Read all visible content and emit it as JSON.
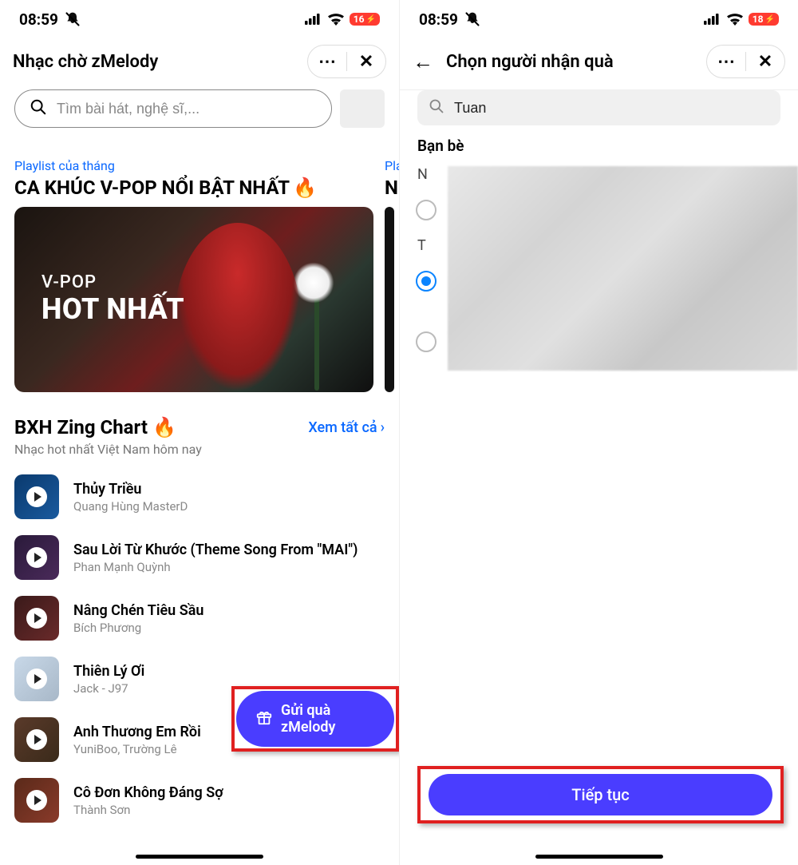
{
  "status": {
    "time": "08:59",
    "battery_left": "16",
    "battery_right": "18"
  },
  "left": {
    "title": "Nhạc chờ zMelody",
    "search_placeholder": "Tìm bài hát, nghệ sĩ,...",
    "playlist_tag": "Playlist của tháng",
    "playlist_title": "CA KHÚC V-POP NỔI BẬT NHẤT",
    "cover_small": "V-POP",
    "cover_big": "HOT NHẤT",
    "peek_tag": "Pla",
    "peek_title": "NH",
    "chart_title": "BXH Zing Chart",
    "chart_viewall": "Xem tất cả",
    "chart_sub": "Nhạc hot nhất Việt Nam hôm nay",
    "songs": [
      {
        "title": "Thủy Triều",
        "artist": "Quang Hùng MasterD"
      },
      {
        "title": "Sau Lời Từ Khước (Theme Song From \"MAI\")",
        "artist": "Phan Mạnh Quỳnh"
      },
      {
        "title": "Nâng Chén Tiêu Sầu",
        "artist": "Bích Phương"
      },
      {
        "title": "Thiên Lý Ơi",
        "artist": "Jack - J97"
      },
      {
        "title": "Anh Thương Em Rồi",
        "artist": "YuniBoo, Trường Lê"
      },
      {
        "title": "Cô Đơn Không Đáng Sợ",
        "artist": "Thành Sơn"
      }
    ],
    "gift_label": "Gửi quà zMelody"
  },
  "right": {
    "title": "Chọn người nhận quà",
    "search_value": "Tuan",
    "friends_label": "Bạn bè",
    "letters": [
      "N",
      "T"
    ],
    "continue_label": "Tiếp tục"
  }
}
